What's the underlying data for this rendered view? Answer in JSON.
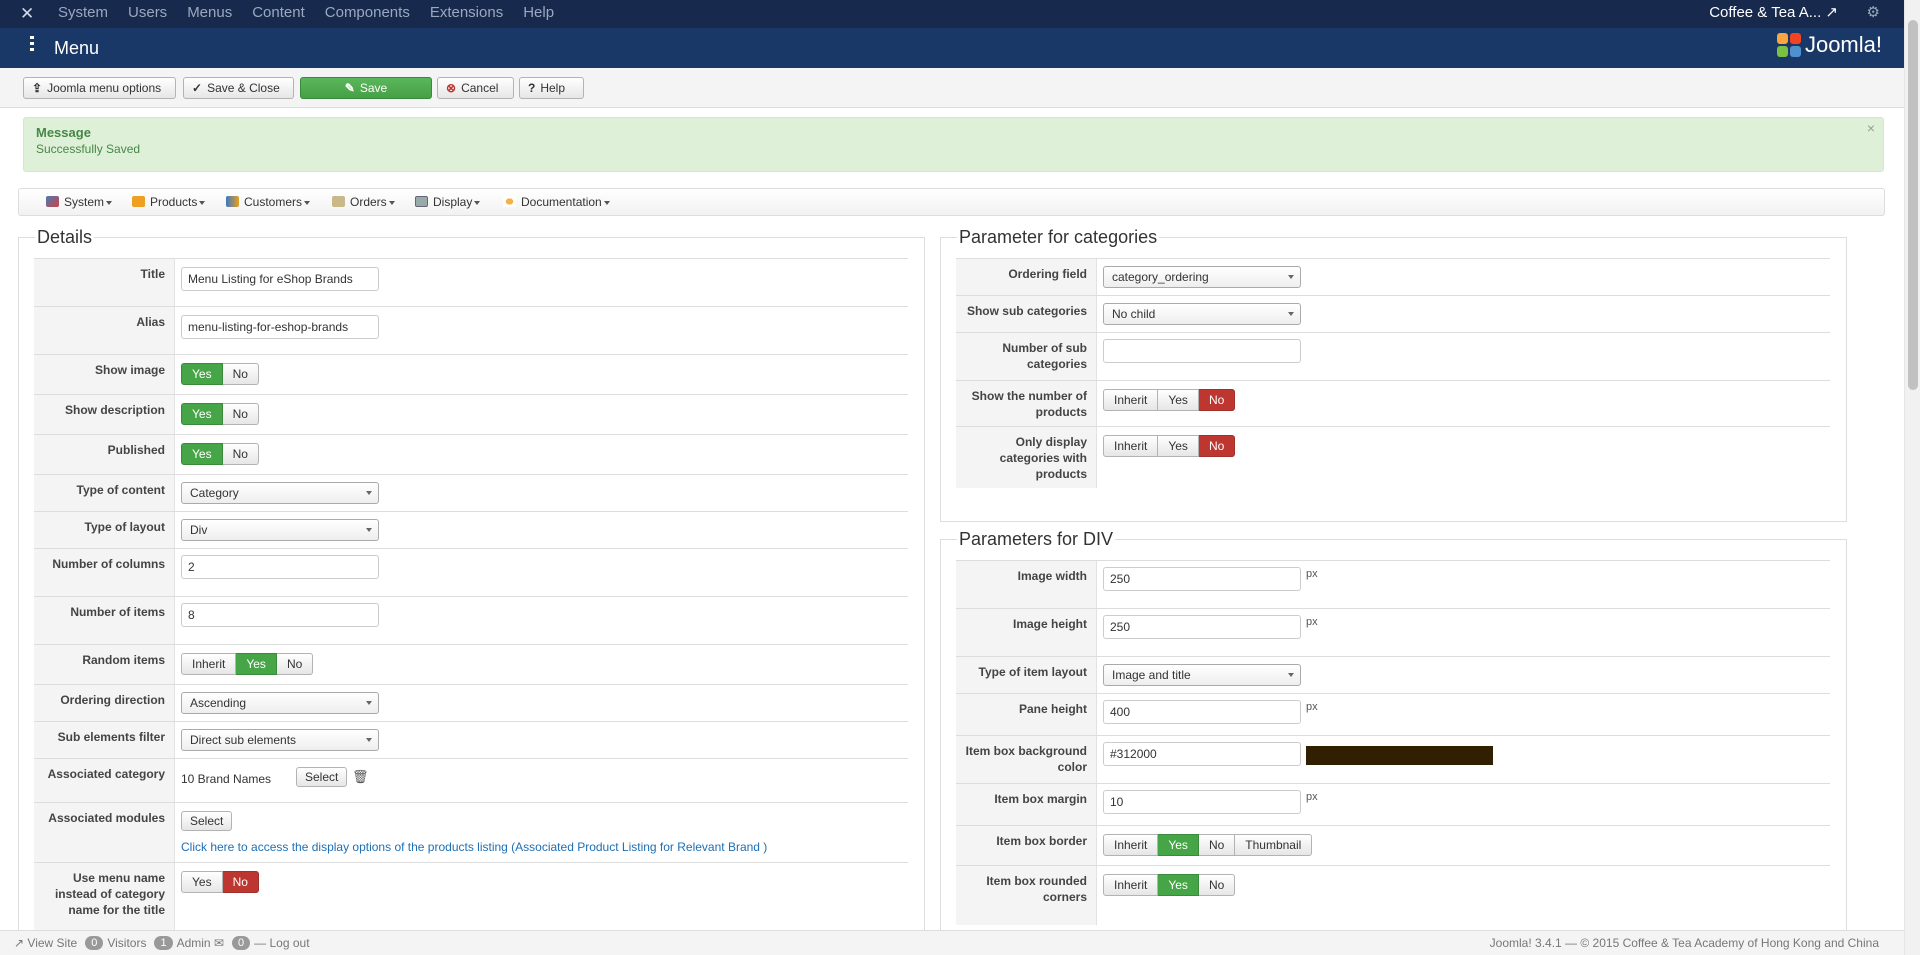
{
  "topnav": {
    "menu": [
      "System",
      "Users",
      "Menus",
      "Content",
      "Components",
      "Extensions",
      "Help"
    ],
    "site_name": "Coffee & Tea A..."
  },
  "header": {
    "title": "Menu",
    "brand": "Joomla!"
  },
  "toolbar": {
    "options_label": "Joomla menu options",
    "save_close_label": "Save & Close",
    "save_label": "Save",
    "cancel_label": "Cancel",
    "help_label": "Help"
  },
  "message": {
    "heading": "Message",
    "body": "Successfully Saved"
  },
  "component_menu": [
    "System",
    "Products",
    "Customers",
    "Orders",
    "Display",
    "Documentation"
  ],
  "details": {
    "legend": "Details",
    "title_label": "Title",
    "title_value": "Menu Listing for eShop Brands",
    "alias_label": "Alias",
    "alias_value": "menu-listing-for-eshop-brands",
    "show_image_label": "Show image",
    "show_description_label": "Show description",
    "published_label": "Published",
    "type_content_label": "Type of content",
    "type_content_value": "Category",
    "type_layout_label": "Type of layout",
    "type_layout_value": "Div",
    "num_columns_label": "Number of columns",
    "num_columns_value": "2",
    "num_items_label": "Number of items",
    "num_items_value": "8",
    "random_items_label": "Random items",
    "ordering_direction_label": "Ordering direction",
    "ordering_direction_value": "Ascending",
    "sub_elements_label": "Sub elements filter",
    "sub_elements_value": "Direct sub elements",
    "assoc_category_label": "Associated category",
    "assoc_category_value": "10 Brand Names",
    "assoc_modules_label": "Associated modules",
    "select_label": "Select",
    "assoc_link": "Click here to access the display options of the products listing (Associated Product Listing for Relevant Brand )",
    "use_menu_name_label": "Use menu name instead of category name for the title",
    "yes": "Yes",
    "no": "No",
    "inherit": "Inherit"
  },
  "categories": {
    "legend": "Parameter for categories",
    "ordering_field_label": "Ordering field",
    "ordering_field_value": "category_ordering",
    "show_sub_label": "Show sub categories",
    "show_sub_value": "No child",
    "num_sub_label": "Number of sub categories",
    "num_sub_value": "",
    "show_num_products_label": "Show the number of products",
    "only_display_label": "Only display categories with products"
  },
  "div_params": {
    "legend": "Parameters for DIV",
    "image_width_label": "Image width",
    "image_width_value": "250",
    "image_height_label": "Image height",
    "image_height_value": "250",
    "item_layout_label": "Type of item layout",
    "item_layout_value": "Image and title",
    "pane_height_label": "Pane height",
    "pane_height_value": "400",
    "item_bg_label": "Item box background color",
    "item_bg_value": "#312000",
    "item_margin_label": "Item box margin",
    "item_margin_value": "10",
    "item_border_label": "Item box border",
    "item_rounded_label": "Item box rounded corners",
    "px": "px",
    "thumbnail": "Thumbnail"
  },
  "colors": {
    "swatch": "#312000",
    "accent_green": "#46a546",
    "accent_red": "#bd362f"
  },
  "status": {
    "view_site": "View Site",
    "visitors_count": "0",
    "visitors_label": "Visitors",
    "admin_count": "1",
    "admin_label": "Admin",
    "messages_count": "0",
    "logout": "Log out",
    "footer": "Joomla! 3.4.1 — © 2015 Coffee & Tea Academy of Hong Kong and China"
  }
}
